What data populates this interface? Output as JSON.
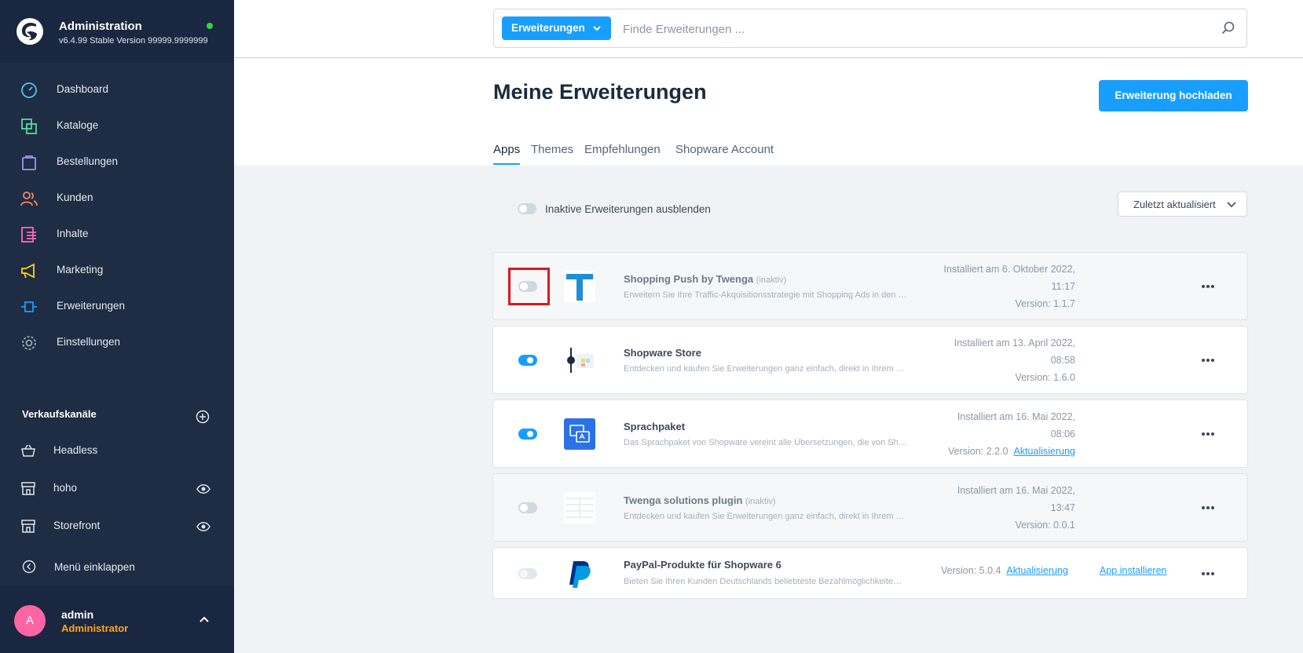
{
  "app": {
    "title": "Administration",
    "version": "v6.4.99 Stable Version 99999.9999999",
    "status_color": "#37d046"
  },
  "nav": {
    "items": [
      {
        "label": "Dashboard",
        "icon": "dashboard-gauge-icon",
        "color": "#4fc3f7"
      },
      {
        "label": "Kataloge",
        "icon": "catalogue-icon",
        "color": "#57d9a3"
      },
      {
        "label": "Bestellungen",
        "icon": "shopping-bag-icon",
        "color": "#a092f0"
      },
      {
        "label": "Kunden",
        "icon": "customers-icon",
        "color": "#f88962"
      },
      {
        "label": "Inhalte",
        "icon": "content-icon",
        "color": "#ff68b4"
      },
      {
        "label": "Marketing",
        "icon": "megaphone-icon",
        "color": "#ffd700"
      },
      {
        "label": "Erweiterungen",
        "icon": "plug-icon",
        "color": "#189eff"
      },
      {
        "label": "Einstellungen",
        "icon": "gear-icon",
        "color": "#9aa8b5"
      }
    ]
  },
  "sales_channels": {
    "title": "Verkaufskanäle",
    "items": [
      {
        "label": "Headless",
        "icon": "basket-icon"
      },
      {
        "label": "hoho",
        "icon": "storefront-icon"
      },
      {
        "label": "Storefront",
        "icon": "storefront-icon"
      }
    ]
  },
  "collapse_label": "Menü einklappen",
  "user": {
    "initial": "A",
    "name": "admin",
    "role": "Administrator"
  },
  "search": {
    "type_label": "Erweiterungen",
    "placeholder": "Finde Erweiterungen ..."
  },
  "page": {
    "title": "Meine Erweiterungen",
    "upload_label": "Erweiterung hochladen",
    "tabs": [
      "Apps",
      "Themes",
      "Empfehlungen",
      "Shopware Account"
    ],
    "active_tab": "Apps",
    "filter_label": "Inaktive Erweiterungen ausblenden",
    "sort_label": "Zuletzt aktualisiert"
  },
  "extensions": [
    {
      "name": "Shopping Push by Twenga",
      "tag": "(inaktiv)",
      "description": "Erweitern Sie Ihre Traffic-Akquisitionsstrategie mit Shopping Ads in den …",
      "installed_line1": "Installiert am 6. Oktober 2022,",
      "installed_line2": "11:17",
      "version": "Version: 1.1.7",
      "active": false,
      "logo": "twenga-t-icon"
    },
    {
      "name": "Shopware Store",
      "tag": "",
      "description": "Entdecken und kaufen Sie Erweiterungen ganz einfach, direkt in Ihrem …",
      "installed_line1": "Installiert am 13. April 2022,",
      "installed_line2": "08:58",
      "version": "Version: 1.6.0",
      "active": true,
      "logo": "shopware-store-icon"
    },
    {
      "name": "Sprachpaket",
      "tag": "",
      "description": "Das Sprachpaket von Shopware vereint alle Übersetzungen, die von Sh…",
      "installed_line1": "Installiert am 16. Mai 2022,",
      "installed_line2": "08:06",
      "version": "Version: 2.2.0",
      "update_label": "Aktualisierung",
      "active": true,
      "logo": "language-pack-icon"
    },
    {
      "name": "Twenga solutions plugin",
      "tag": "(inaktiv)",
      "description": "Entdecken und kaufen Sie Erweiterungen ganz einfach, direkt in Ihrem …",
      "installed_line1": "Installiert am 16. Mai 2022,",
      "installed_line2": "13:47",
      "version": "Version: 0.0.1",
      "active": false,
      "logo": "placeholder-grid-icon"
    },
    {
      "name": "PayPal-Produkte für Shopware 6",
      "tag": "",
      "description": "Bieten Sie Ihren Kunden Deutschlands beliebteste Bezahlmöglichkeite…",
      "version": "Version: 5.0.4",
      "update_label": "Aktualisierung",
      "install_label": "App installieren",
      "active": false,
      "logo": "paypal-icon"
    }
  ]
}
